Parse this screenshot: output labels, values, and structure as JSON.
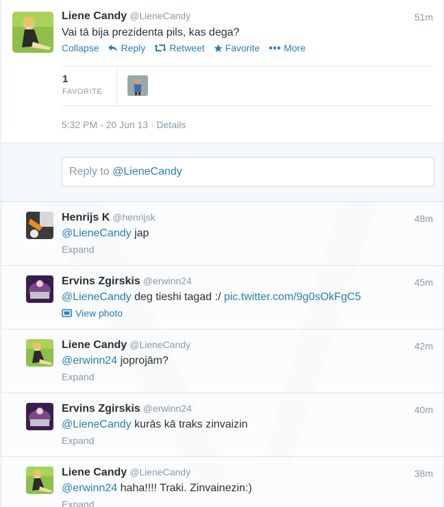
{
  "main_tweet": {
    "name": "Liene Candy",
    "handle": "@LieneCandy",
    "time": "51m",
    "text": "Vai tā bija prezidenta pils, kas dega?",
    "actions": {
      "collapse": "Collapse",
      "reply": "Reply",
      "retweet": "Retweet",
      "favorite": "Favorite",
      "more": "More"
    },
    "favorites_count": "1",
    "favorites_label": "FAVORITE",
    "timestamp": "5:32 PM - 20 Jun 13",
    "details_link": "Details"
  },
  "reply_box": {
    "prefix": "Reply to ",
    "mention": "@LieneCandy"
  },
  "replies": [
    {
      "name": "Henrijs K",
      "handle": "@henrijsk",
      "time": "48m",
      "mention": "@LieneCandy",
      "text": " jap",
      "link": "",
      "footer": "Expand"
    },
    {
      "name": "Ervins Zgirskis",
      "handle": "@erwinn24",
      "time": "45m",
      "mention": "@LieneCandy",
      "text": " deg tieshi tagad :/ ",
      "link": "pic.twitter.com/9g0sOkFgC5",
      "footer": "View photo"
    },
    {
      "name": "Liene Candy",
      "handle": "@LieneCandy",
      "time": "42m",
      "mention": "@erwinn24",
      "text": " joprojām?",
      "link": "",
      "footer": "Expand"
    },
    {
      "name": "Ervins Zgirskis",
      "handle": "@erwinn24",
      "time": "40m",
      "mention": "@LieneCandy",
      "text": " kurās kā traks zinvaizin",
      "link": "",
      "footer": "Expand"
    },
    {
      "name": "Liene Candy",
      "handle": "@LieneCandy",
      "time": "38m",
      "mention": "@erwinn24",
      "text": " haha!!!! Traki. Zinvainezin:)",
      "link": "",
      "footer": "Expand"
    }
  ],
  "colors": {
    "link": "#2b7bb9",
    "muted": "#8899a6",
    "text": "#292f33",
    "border": "#e1e8ed"
  },
  "icons": [
    "reply-arrow-icon",
    "retweet-icon",
    "star-icon",
    "more-dots-icon",
    "photo-icon"
  ]
}
